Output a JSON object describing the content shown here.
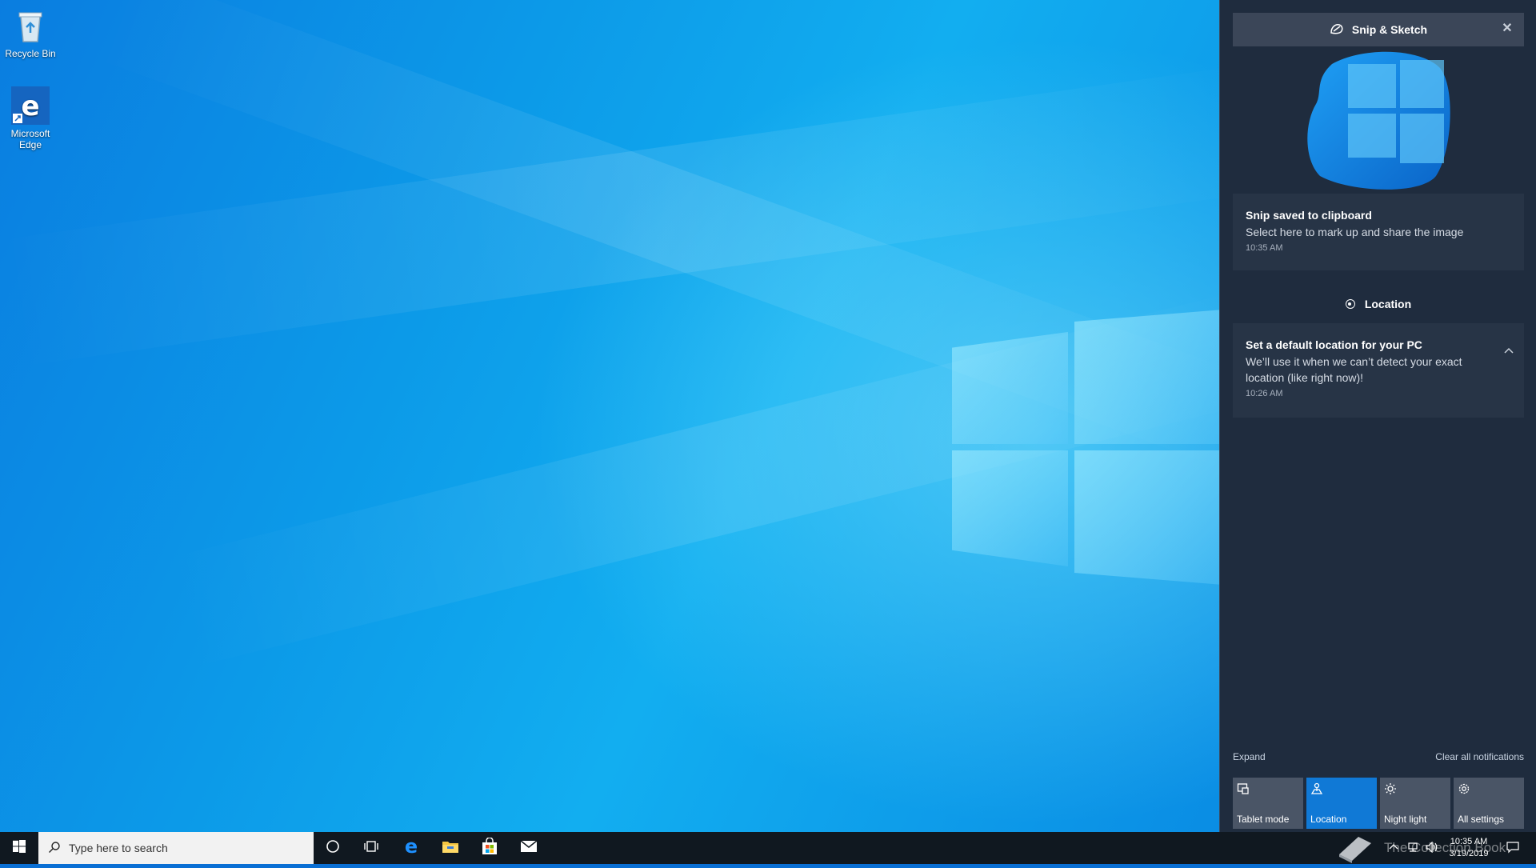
{
  "desktop": {
    "icons": [
      {
        "label": "Recycle Bin"
      },
      {
        "label": "Microsoft Edge"
      }
    ]
  },
  "action_center": {
    "snip_group": {
      "app_name": "Snip & Sketch",
      "close_glyph": "✕",
      "toast": {
        "title": "Snip saved to clipboard",
        "body": "Select here to mark up and share the image",
        "time": "10:35 AM"
      }
    },
    "location_group": {
      "header": "Location",
      "toast": {
        "title": "Set a default location for your PC",
        "body": "We’ll use it when we can’t detect your exact location (like right now)!",
        "time": "10:26 AM"
      }
    },
    "expand_label": "Expand",
    "clear_label": "Clear all notifications",
    "quick_actions": [
      {
        "label": "Tablet mode",
        "icon": "tablet-mode-icon",
        "on": false
      },
      {
        "label": "Location",
        "icon": "location-icon",
        "on": true
      },
      {
        "label": "Night light",
        "icon": "night-light-icon",
        "on": false
      },
      {
        "label": "All settings",
        "icon": "gear-icon",
        "on": false
      }
    ],
    "accent_color": "#1079d6"
  },
  "taskbar": {
    "search_placeholder": "Type here to search",
    "clock_time": "10:35 AM",
    "clock_date": "3/19/2019",
    "watermark": "The Collection Book"
  }
}
